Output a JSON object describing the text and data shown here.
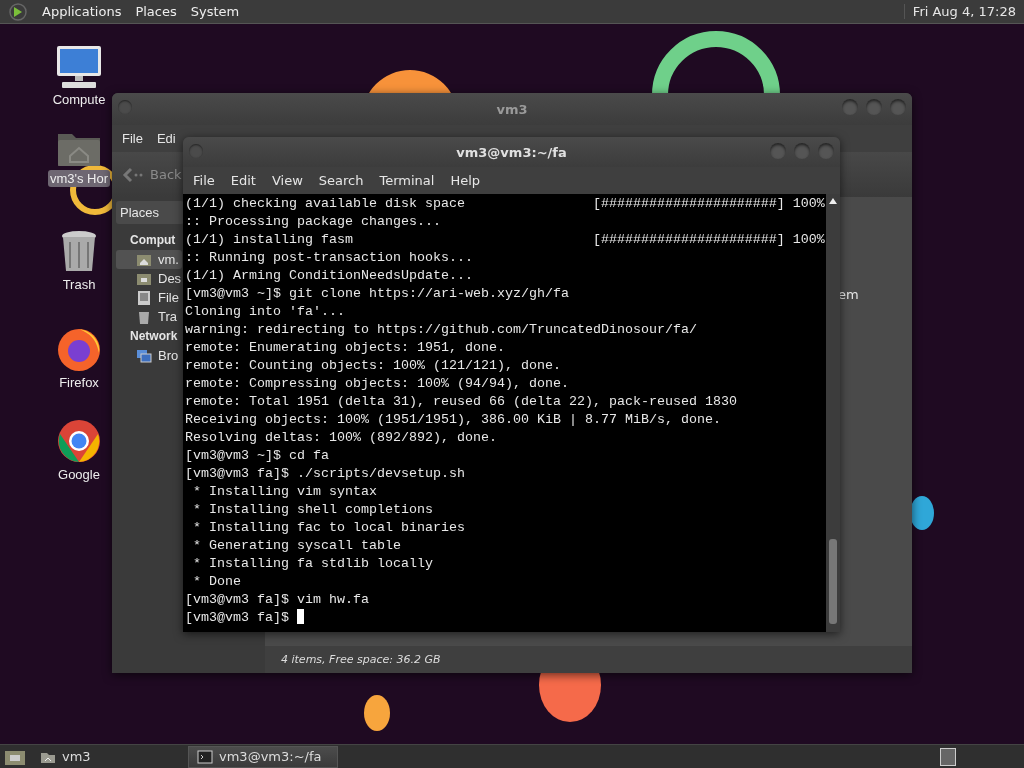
{
  "top_panel": {
    "menus": [
      "Applications",
      "Places",
      "System"
    ],
    "clock": "Fri Aug 4, 17:28"
  },
  "desktop_icons": [
    {
      "kind": "computer",
      "label": "Compute",
      "selected": false
    },
    {
      "kind": "home",
      "label": "vm3's Hor",
      "selected": true
    },
    {
      "kind": "trash",
      "label": "Trash",
      "selected": false
    },
    {
      "kind": "firefox",
      "label": "Firefox",
      "selected": false
    },
    {
      "kind": "chrome",
      "label": "Google",
      "selected": false
    }
  ],
  "file_manager": {
    "title": "vm3",
    "menus": [
      "File",
      "Edi"
    ],
    "back": {
      "label": "Back",
      "disabled": true
    },
    "places": "Places",
    "sidebar": [
      {
        "heading": "Comput",
        "items": [
          {
            "kind": "home",
            "label": "vm.",
            "selected": true
          },
          {
            "kind": "desktop",
            "label": "Des",
            "selected": false
          },
          {
            "kind": "drive",
            "label": "File",
            "selected": false
          },
          {
            "kind": "trash",
            "label": "Tra",
            "selected": false
          }
        ]
      },
      {
        "heading": "Network",
        "items": [
          {
            "kind": "network",
            "label": "Bro",
            "selected": false
          }
        ]
      }
    ],
    "item_label": "em",
    "status": "4 items, Free space: 36.2 GB"
  },
  "terminal": {
    "title": "vm3@vm3:~/fa",
    "menus": [
      "File",
      "Edit",
      "View",
      "Search",
      "Terminal",
      "Help"
    ],
    "lines": [
      "(1/1) checking available disk space                [######################] 100%",
      ":: Processing package changes...",
      "(1/1) installing fasm                              [######################] 100%",
      ":: Running post-transaction hooks...",
      "(1/1) Arming ConditionNeedsUpdate...",
      "[vm3@vm3 ~]$ git clone https://ari-web.xyz/gh/fa",
      "Cloning into 'fa'...",
      "warning: redirecting to https://github.com/TruncatedDinosour/fa/",
      "remote: Enumerating objects: 1951, done.",
      "remote: Counting objects: 100% (121/121), done.",
      "remote: Compressing objects: 100% (94/94), done.",
      "remote: Total 1951 (delta 31), reused 66 (delta 22), pack-reused 1830",
      "Receiving objects: 100% (1951/1951), 386.00 KiB | 8.77 MiB/s, done.",
      "Resolving deltas: 100% (892/892), done.",
      "[vm3@vm3 ~]$ cd fa",
      "[vm3@vm3 fa]$ ./scripts/devsetup.sh",
      " * Installing vim syntax",
      " * Installing shell completions",
      " * Installing fac to local binaries",
      " * Generating syscall table",
      " * Installing fa stdlib locally",
      " * Done",
      "[vm3@vm3 fa]$ vim hw.fa",
      "[vm3@vm3 fa]$ "
    ]
  },
  "taskbar": {
    "tasks": [
      {
        "kind": "folder",
        "label": "vm3",
        "selected": false
      },
      {
        "kind": "terminal",
        "label": "vm3@vm3:~/fa",
        "selected": true
      }
    ]
  }
}
